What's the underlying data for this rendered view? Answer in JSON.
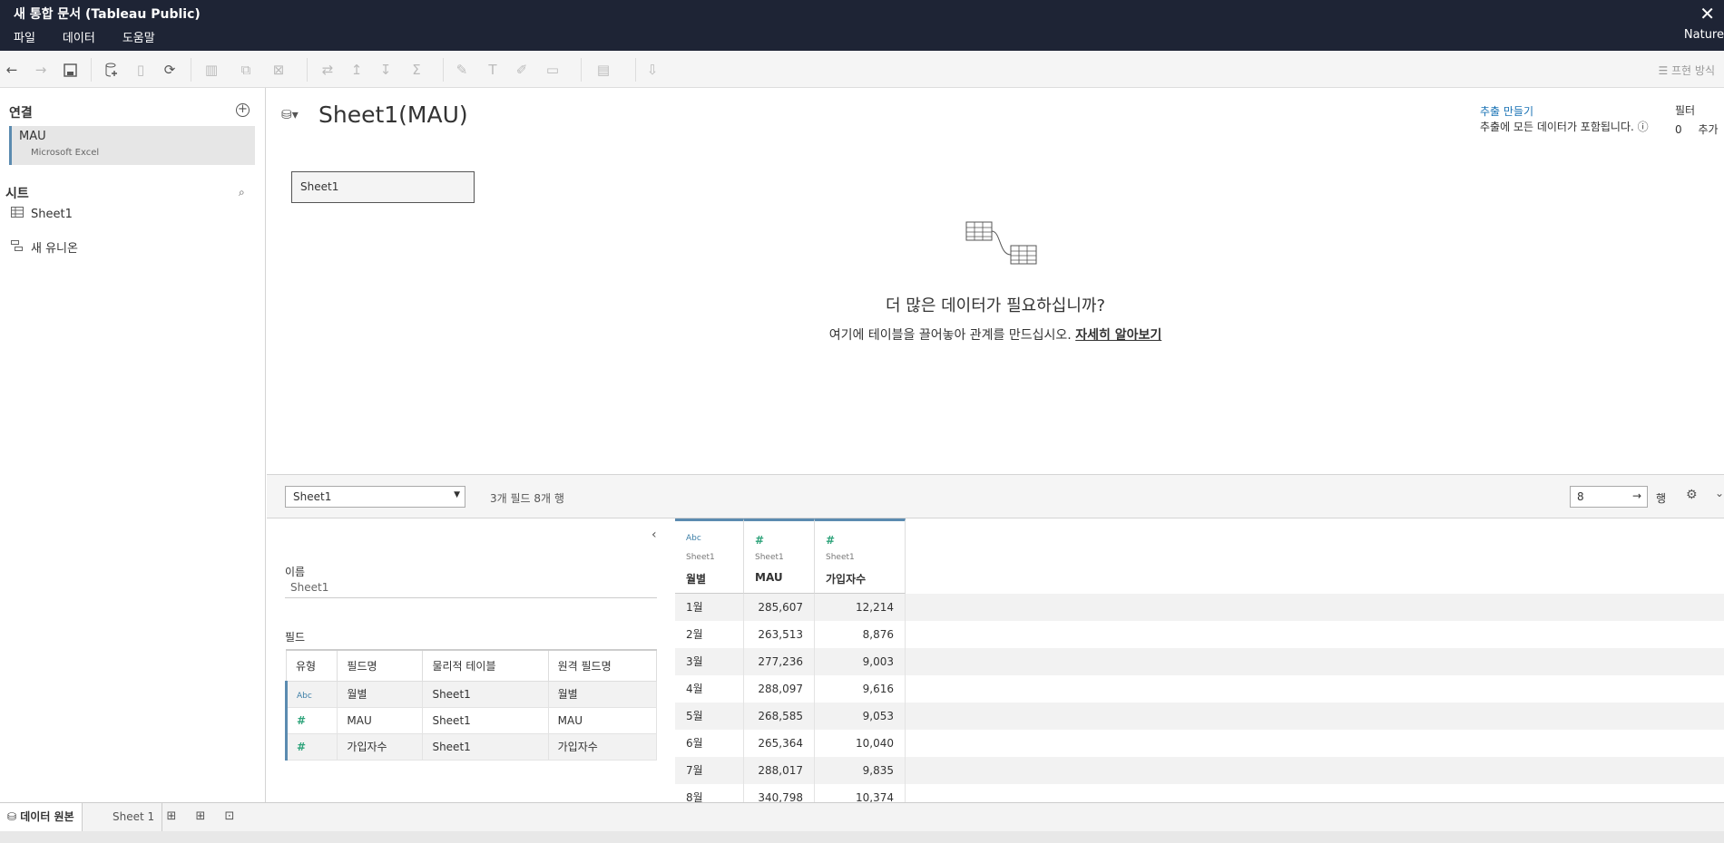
{
  "window": {
    "title": "새 통합 문서 (Tableau Public)",
    "close": "✕",
    "user": "Nature"
  },
  "menu": [
    "파일",
    "데이터",
    "도움말"
  ],
  "toolbar": {
    "presentation": "프현 방식"
  },
  "left": {
    "connections_title": "연결",
    "connection": {
      "name": "MAU",
      "type": "Microsoft Excel"
    },
    "sheets_title": "시트",
    "sheet_item": "Sheet1",
    "new_union": "새 유니온"
  },
  "canvas": {
    "title": "Sheet1(MAU)",
    "extract_link": "추출 만들기",
    "extract_note": "추출에 모든 데이터가 포함됩니다. ⓘ",
    "filter_label": "필터",
    "filter_count": "0",
    "filter_add": "추가",
    "table_name": "Sheet1",
    "empty_heading": "더 많은 데이터가 필요하십니까?",
    "empty_sub": "여기에 테이블을 끌어놓아 관계를 만드십시오. ",
    "learn_more": "자세히 알아보기"
  },
  "gridbar": {
    "table_select": "Sheet1",
    "summary": "3개 필드 8개 행",
    "rows_value": "8",
    "rows_label": "행"
  },
  "meta": {
    "name_label": "이름",
    "name_value": "Sheet1",
    "fields_label": "필드",
    "headers": [
      "유형",
      "필드명",
      "물리적 테이블",
      "원격 필드명"
    ],
    "rows": [
      {
        "type": "Abc",
        "name": "월별",
        "table": "Sheet1",
        "remote": "월별"
      },
      {
        "type": "#",
        "name": "MAU",
        "table": "Sheet1",
        "remote": "MAU"
      },
      {
        "type": "#",
        "name": "가입자수",
        "table": "Sheet1",
        "remote": "가입자수"
      }
    ]
  },
  "grid": {
    "columns": [
      {
        "type": "Abc",
        "source": "Sheet1",
        "name": "월별"
      },
      {
        "type": "#",
        "source": "Sheet1",
        "name": "MAU"
      },
      {
        "type": "#",
        "source": "Sheet1",
        "name": "가입자수"
      }
    ],
    "rows": [
      [
        "1월",
        "285,607",
        "12,214"
      ],
      [
        "2월",
        "263,513",
        "8,876"
      ],
      [
        "3월",
        "277,236",
        "9,003"
      ],
      [
        "4월",
        "288,097",
        "9,616"
      ],
      [
        "5월",
        "268,585",
        "9,053"
      ],
      [
        "6월",
        "265,364",
        "10,040"
      ],
      [
        "7월",
        "288,017",
        "9,835"
      ],
      [
        "8월",
        "340,798",
        "10,374"
      ]
    ]
  },
  "bottom": {
    "data_source_tab": "데이터 원본",
    "sheet_tab": "Sheet 1"
  }
}
